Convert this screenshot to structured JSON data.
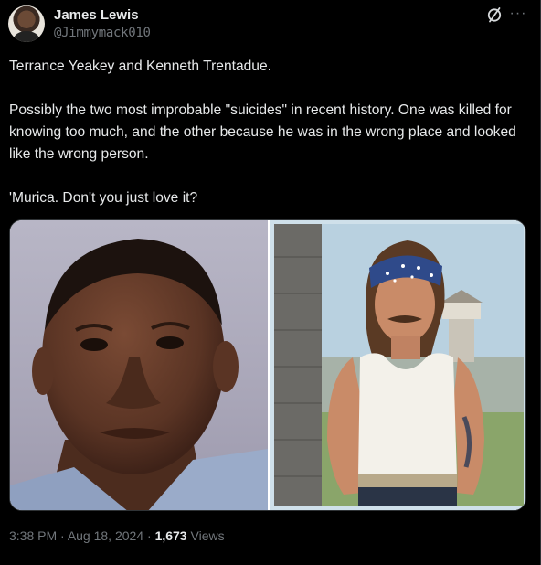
{
  "user": {
    "name": "James Lewis",
    "handle": "@Jimmymack010"
  },
  "icons": {
    "grok": "grok-slash-icon",
    "more": "more-dots-icon"
  },
  "tweet": {
    "text": "Terrance Yeakey and Kenneth Trentadue.\n\nPossibly the two most improbable \"suicides\" in recent history.  One was killed for knowing too much, and the other because he was in the wrong place and looked like the wrong person.\n\n'Murica.  Don't you just love it?"
  },
  "meta": {
    "time": "3:38 PM",
    "sep1": " · ",
    "date": "Aug 18, 2024",
    "sep2": " · ",
    "views_count": "1,673",
    "views_label": " Views"
  },
  "colors": {
    "background": "#000000",
    "text": "#e7e9ea",
    "muted": "#71767b",
    "border": "#2f3336"
  }
}
